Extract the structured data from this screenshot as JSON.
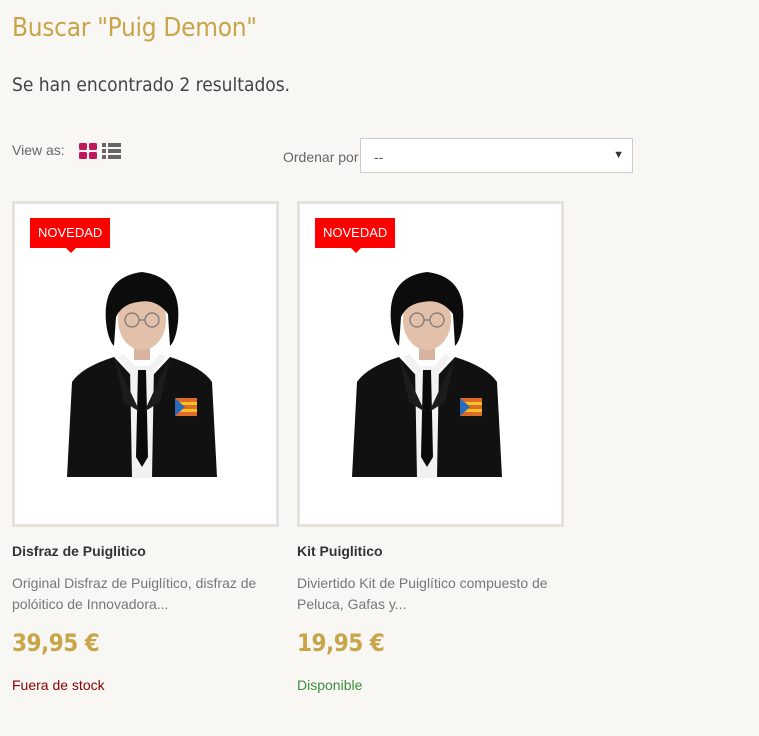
{
  "search": {
    "title": "Buscar \"Puig Demon\"",
    "results_text": "Se han encontrado 2 resultados."
  },
  "toolbar": {
    "view_as_label": "View as:",
    "view_grid_icon": "grid-icon",
    "view_list_icon": "list-icon",
    "active_view_color": "#c2185b",
    "order_label": "Ordenar por",
    "order_value": "--"
  },
  "products": [
    {
      "badge": "NOVEDAD",
      "name": "Disfraz de Puiglitico",
      "description": "Original Disfraz de Puiglítico, disfraz de polóitico de Innovadora...",
      "price": "39,95 €",
      "availability": "Fuera de stock",
      "availability_color": "#8b0000"
    },
    {
      "badge": "NOVEDAD",
      "name": "Kit Puiglitico",
      "description": "Diviertido Kit de Puiglítico compuesto de Peluca, Gafas  y...",
      "price": "19,95 €",
      "availability": "Disponible",
      "availability_color": "#3c8c3c"
    }
  ]
}
